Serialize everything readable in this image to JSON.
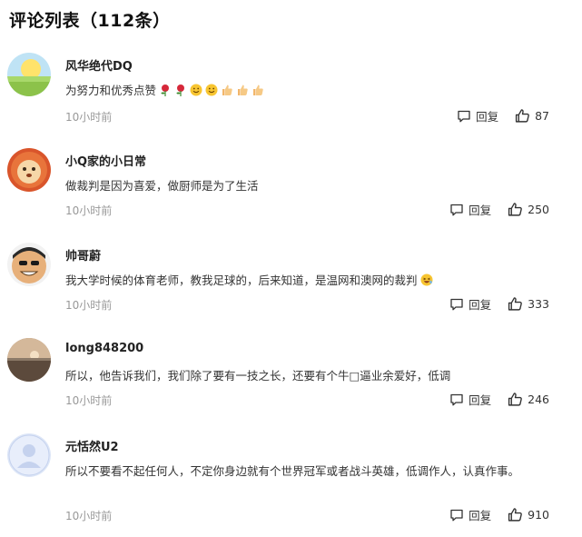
{
  "header": {
    "title": "评论列表（112条）"
  },
  "comments": [
    {
      "name": "风华绝代DQ",
      "text": "为努力和优秀点赞",
      "emojis": [
        "rose-emoji",
        "rose-emoji",
        "smile-emoji",
        "smile-emoji",
        "thumbs-up-emoji",
        "thumbs-up-emoji",
        "thumbs-up-emoji"
      ],
      "time": "10小时前",
      "reply_label": "回复",
      "likes": "87"
    },
    {
      "name": "小Q家的小日常",
      "text": "做裁判是因为喜爱，做厨师是为了生活",
      "emojis": [],
      "time": "10小时前",
      "reply_label": "回复",
      "likes": "250"
    },
    {
      "name": "帅哥蔚",
      "text": "我大学时候的体育老师，教我足球的，后来知道，是温网和澳网的裁判",
      "emojis": [
        "laugh-emoji"
      ],
      "time": "10小时前",
      "reply_label": "回复",
      "likes": "333"
    },
    {
      "name": "long848200",
      "text": "所以，他告诉我们，我们除了要有一技之长，还要有个牛□逼业余爱好，低调",
      "emojis": [],
      "time": "10小时前",
      "reply_label": "回复",
      "likes": "246"
    },
    {
      "name": "元恬然U2",
      "text": "所以不要看不起任何人，不定你身边就有个世界冠军或者战斗英雄，低调作人，认真作事。",
      "emojis": [],
      "time": "10小时前",
      "reply_label": "回复",
      "likes": "910"
    }
  ]
}
